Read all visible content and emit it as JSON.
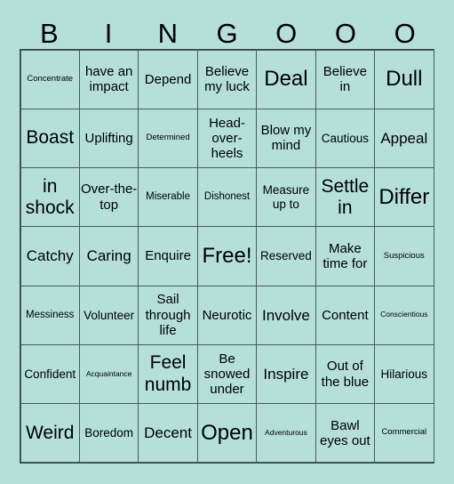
{
  "header": {
    "letters": [
      "B",
      "I",
      "N",
      "G",
      "O",
      "O",
      "O"
    ]
  },
  "grid": {
    "rows": [
      [
        "Concentrate",
        "have an impact",
        "Depend",
        "Believe my luck",
        "Deal",
        "Believe in",
        "Dull"
      ],
      [
        "Boast",
        "Uplifting",
        "Determined",
        "Head-over-heels",
        "Blow my mind",
        "Cautious",
        "Appeal"
      ],
      [
        "in shock",
        "Over-the-top",
        "Miserable",
        "Dishonest",
        "Measure up to",
        "Settle in",
        "Differ"
      ],
      [
        "Catchy",
        "Caring",
        "Enquire",
        "Free!",
        "Reserved",
        "Make time for",
        "Suspicious"
      ],
      [
        "Messiness",
        "Volunteer",
        "Sail through life",
        "Neurotic",
        "Involve",
        "Content",
        "Conscientious"
      ],
      [
        "Confident",
        "Acquaintance",
        "Feel numb",
        "Be snowed under",
        "Inspire",
        "Out of the blue",
        "Hilarious"
      ],
      [
        "Weird",
        "Boredom",
        "Decent",
        "Open",
        "Adventurous",
        "Bawl eyes out",
        "Commercial"
      ]
    ],
    "free_space_label": "Free!"
  },
  "colors": {
    "background": "#b5e0da",
    "grid_line": "#4a5a58",
    "text": "#000000"
  }
}
